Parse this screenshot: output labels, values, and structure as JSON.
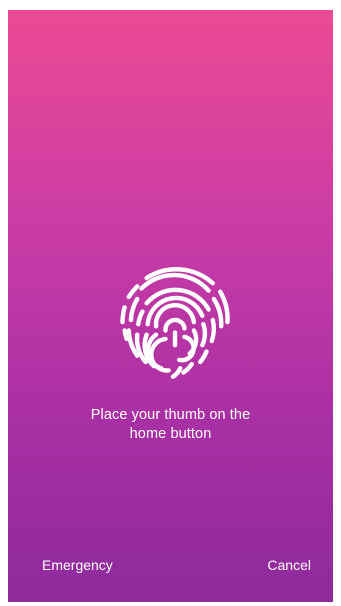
{
  "prompt": {
    "line1": "Place your thumb on the",
    "line2": "home button"
  },
  "buttons": {
    "emergency": "Emergency",
    "cancel": "Cancel"
  },
  "icons": {
    "fingerprint": "fingerprint-icon"
  },
  "colors": {
    "gradient_top": "#ec4a93",
    "gradient_bottom": "#8e2a9c",
    "text": "#ffffff"
  }
}
